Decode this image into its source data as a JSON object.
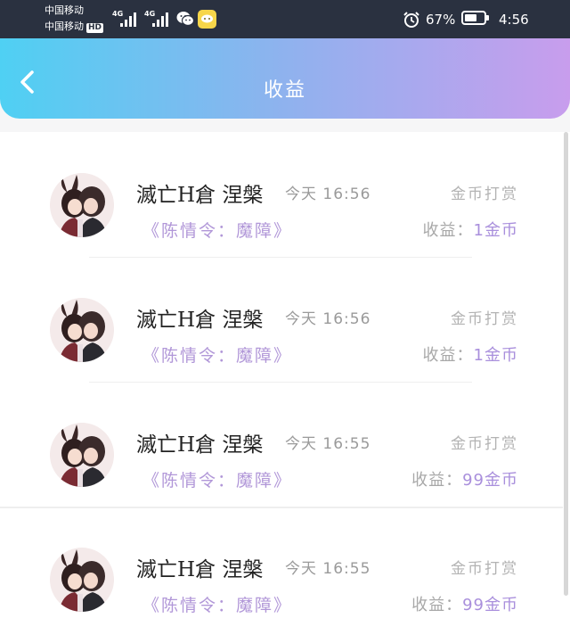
{
  "status_bar": {
    "carrier_1": "中国移动",
    "carrier_2": "中国移动",
    "hd_badge": "HD",
    "network_1": "4G",
    "network_2": "4G",
    "battery_percent": "67%",
    "battery_level": 0.67,
    "time": "4:56",
    "icons": [
      "signal-icon",
      "wechat-icon",
      "message-app-icon",
      "alarm-icon",
      "battery-icon"
    ]
  },
  "header": {
    "title": "收益",
    "back_icon": "chevron-left-icon"
  },
  "colors": {
    "header_gradient": [
      "#4fd0f3",
      "#8fb2ee",
      "#c89ded"
    ],
    "accent_purple": "#a98fdc",
    "status_bar_bg": "#2a3140"
  },
  "items": [
    {
      "user": "滅亡H倉 涅槃",
      "time": "今天 16:56",
      "type": "金币打赏",
      "work": "《陈情令：魔障》",
      "income_label": "收益：",
      "income_value": "1金币"
    },
    {
      "user": "滅亡H倉 涅槃",
      "time": "今天 16:56",
      "type": "金币打赏",
      "work": "《陈情令：魔障》",
      "income_label": "收益：",
      "income_value": "1金币"
    },
    {
      "user": "滅亡H倉 涅槃",
      "time": "今天 16:55",
      "type": "金币打赏",
      "work": "《陈情令：魔障》",
      "income_label": "收益：",
      "income_value": "99金币"
    },
    {
      "user": "滅亡H倉 涅槃",
      "time": "今天 16:55",
      "type": "金币打赏",
      "work": "《陈情令：魔障》",
      "income_label": "收益：",
      "income_value": "99金币"
    }
  ]
}
